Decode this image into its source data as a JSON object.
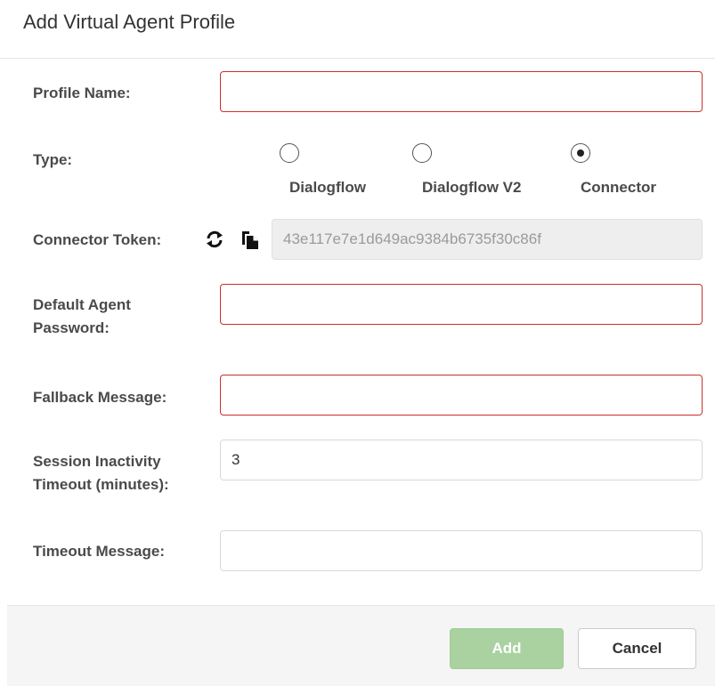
{
  "header": {
    "title": "Add Virtual Agent Profile"
  },
  "form": {
    "profile_name": {
      "label": "Profile Name:",
      "value": ""
    },
    "type": {
      "label": "Type:",
      "options": [
        {
          "label": "Dialogflow",
          "checked": false
        },
        {
          "label": "Dialogflow V2",
          "checked": false
        },
        {
          "label": "Connector",
          "checked": true
        }
      ]
    },
    "connector_token": {
      "label": "Connector Token:",
      "value": "43e117e7e1d649ac9384b6735f30c86f",
      "refresh_icon": "refresh-icon",
      "copy_icon": "copy-icon"
    },
    "default_agent_password": {
      "label_line1": "Default Agent",
      "label_line2": "Password:",
      "value": ""
    },
    "fallback_message": {
      "label": "Fallback Message:",
      "value": ""
    },
    "session_inactivity_timeout": {
      "label_line1": "Session Inactivity",
      "label_line2": "Timeout (minutes):",
      "value": "3"
    },
    "timeout_message": {
      "label": "Timeout Message:",
      "value": ""
    }
  },
  "footer": {
    "add_label": "Add",
    "cancel_label": "Cancel"
  },
  "colors": {
    "error_border": "#c9302c",
    "add_button_bg": "#a9d2a0",
    "footer_bg": "#f5f5f5",
    "disabled_input_bg": "#eeeeee"
  }
}
